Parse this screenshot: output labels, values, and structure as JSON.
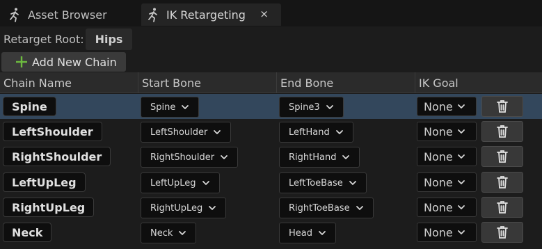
{
  "tabs": [
    {
      "label": "Asset Browser"
    },
    {
      "label": "IK Retargeting",
      "close": "×"
    }
  ],
  "retarget_root": {
    "label": "Retarget Root:",
    "value": "Hips"
  },
  "add_chain_label": "Add New Chain",
  "columns": [
    "Chain Name",
    "Start Bone",
    "End Bone",
    "IK Goal"
  ],
  "chains": [
    {
      "name": "Spine",
      "start": "Spine",
      "end": "Spine3",
      "goal": "None",
      "selected": true
    },
    {
      "name": "LeftShoulder",
      "start": "LeftShoulder",
      "end": "LeftHand",
      "goal": "None"
    },
    {
      "name": "RightShoulder",
      "start": "RightShoulder",
      "end": "RightHand",
      "goal": "None"
    },
    {
      "name": "LeftUpLeg",
      "start": "LeftUpLeg",
      "end": "LeftToeBase",
      "goal": "None"
    },
    {
      "name": "RightUpLeg",
      "start": "RightUpLeg",
      "end": "RightToeBase",
      "goal": "None"
    },
    {
      "name": "Neck",
      "start": "Neck",
      "end": "Head",
      "goal": "None"
    }
  ],
  "colors": {
    "selected_row": "#33475c",
    "add_icon": "#6dbb3f"
  },
  "icons": {
    "tab_icon": "running-figure-icon",
    "add": "plus-icon",
    "dropdown": "chevron-down-icon",
    "delete": "trash-icon"
  }
}
